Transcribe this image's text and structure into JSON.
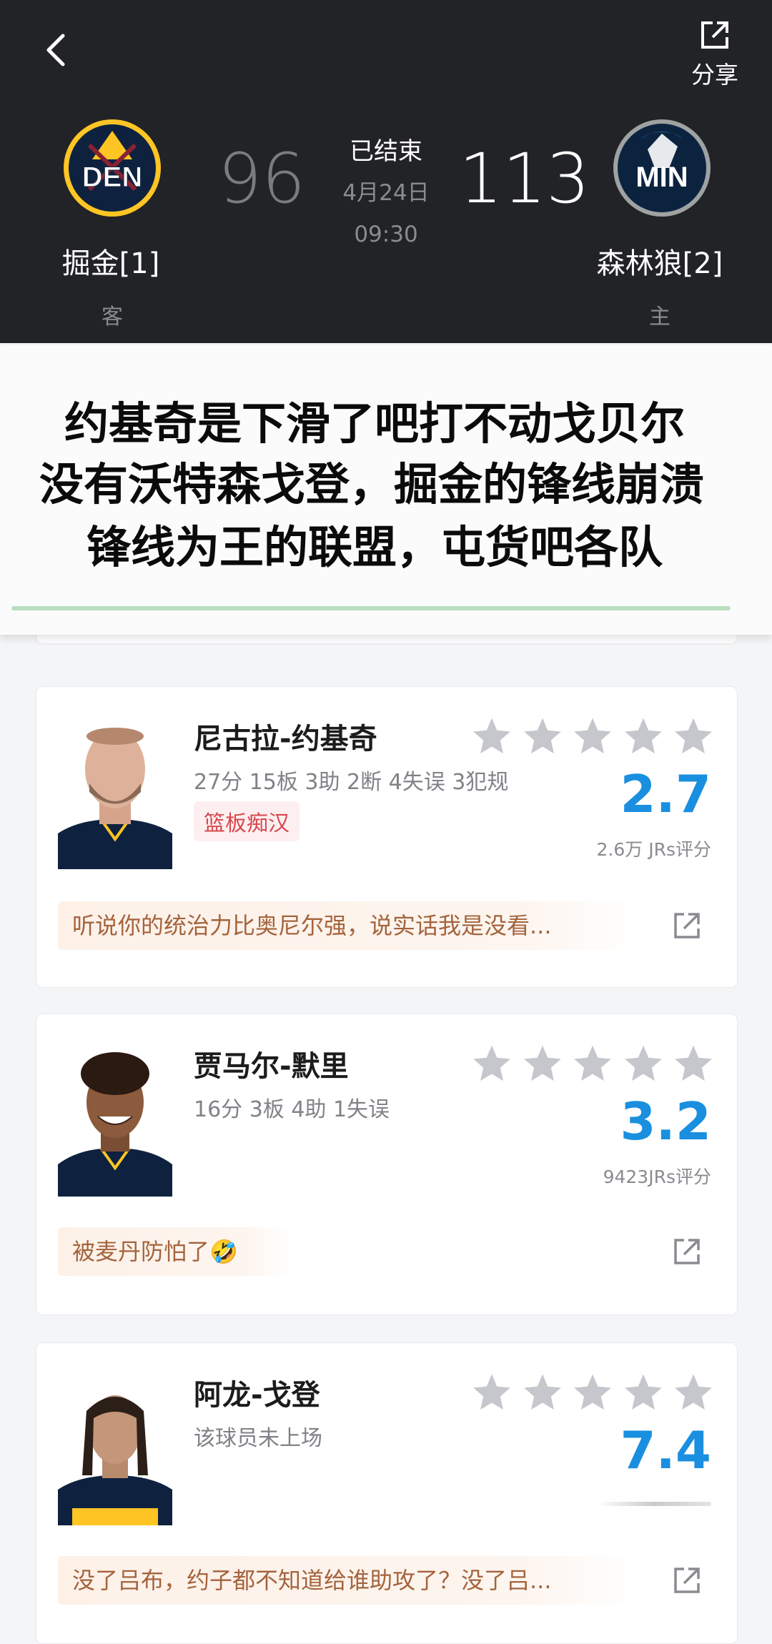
{
  "header": {
    "share_label": "分享",
    "away": {
      "abbr": "DEN",
      "name": "掘金[1]",
      "side": "客",
      "score": "96",
      "color": "#0e2240",
      "accent": "#fec524"
    },
    "home": {
      "abbr": "MIN",
      "name": "森林狼[2]",
      "side": "主",
      "score": "113",
      "color": "#0c2340",
      "accent": "#78be20"
    },
    "status": "已结束",
    "date": "4月24日",
    "time": "09:30"
  },
  "caption": {
    "lines": [
      "约基奇是下滑了吧打不动戈贝尔",
      "没有沃特森戈登，掘金的锋线崩溃",
      "锋线为王的联盟，屯货吧各队"
    ]
  },
  "players": [
    {
      "name": "尼古拉-约基奇",
      "stats": "27分 15板 3助 2断 4失误 3犯规",
      "tag": "篮板痴汉",
      "rating": "2.7",
      "rating_count": "2.6万 JRs评分",
      "comment": "听说你的统治力比奥尼尔强，说实话我是没看...",
      "stars_filled": 0
    },
    {
      "name": "贾马尔-默里",
      "stats": "16分 3板 4助 1失误",
      "tag": "",
      "rating": "3.2",
      "rating_count": "9423JRs评分",
      "comment": "被麦丹防怕了",
      "comment_emoji": "🤣",
      "stars_filled": 0
    },
    {
      "name": "阿龙-戈登",
      "stats": "该球员未上场",
      "tag": "",
      "rating": "7.4",
      "rating_count": "",
      "comment": "没了吕布，约子都不知道给谁助攻了？没了吕...",
      "stars_filled": 0
    }
  ],
  "icons": {
    "back": "chevron-left-icon",
    "share": "share-icon",
    "star": "star-icon",
    "open": "external-link-icon"
  },
  "colors": {
    "header_bg": "#222326",
    "rating_blue": "#1a8fe0",
    "tag_red": "#d6494f",
    "comment_text": "#a4643d",
    "star_grey": "#c5c7cc"
  }
}
